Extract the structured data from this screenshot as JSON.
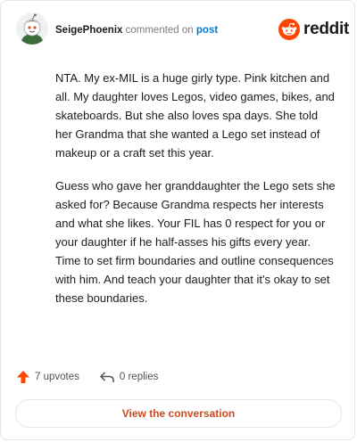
{
  "comment": {
    "author": "SeigePhoenix",
    "action_text": "commented on",
    "post_link": "post",
    "avatar_icon": "snoo-avatar-icon"
  },
  "brand": {
    "name": "reddit",
    "logo_icon": "reddit-snoo-icon",
    "accent": "#ff4500"
  },
  "body": {
    "paragraphs": [
      "NTA. My ex-MIL is a huge girly type. Pink kitchen and all. My daughter loves Legos, video games, bikes, and skateboards. But she also loves spa days. She told her Grandma that she wanted a Lego set instead of makeup or a craft set this year.",
      "Guess who gave her granddaughter the Lego sets she asked for? Because Grandma respects her interests and what she likes. Your FIL has 0 respect for you or your daughter if he half-asses his gifts every year. Time to set firm boundaries and outline consequences with him. And teach your daughter that it's okay to set these boundaries."
    ]
  },
  "stats": {
    "upvotes": "7 upvotes",
    "replies": "0 replies",
    "upvote_icon": "upvote-arrow-icon",
    "reply_icon": "reply-arrow-icon"
  },
  "cta": {
    "label": "View the conversation"
  }
}
